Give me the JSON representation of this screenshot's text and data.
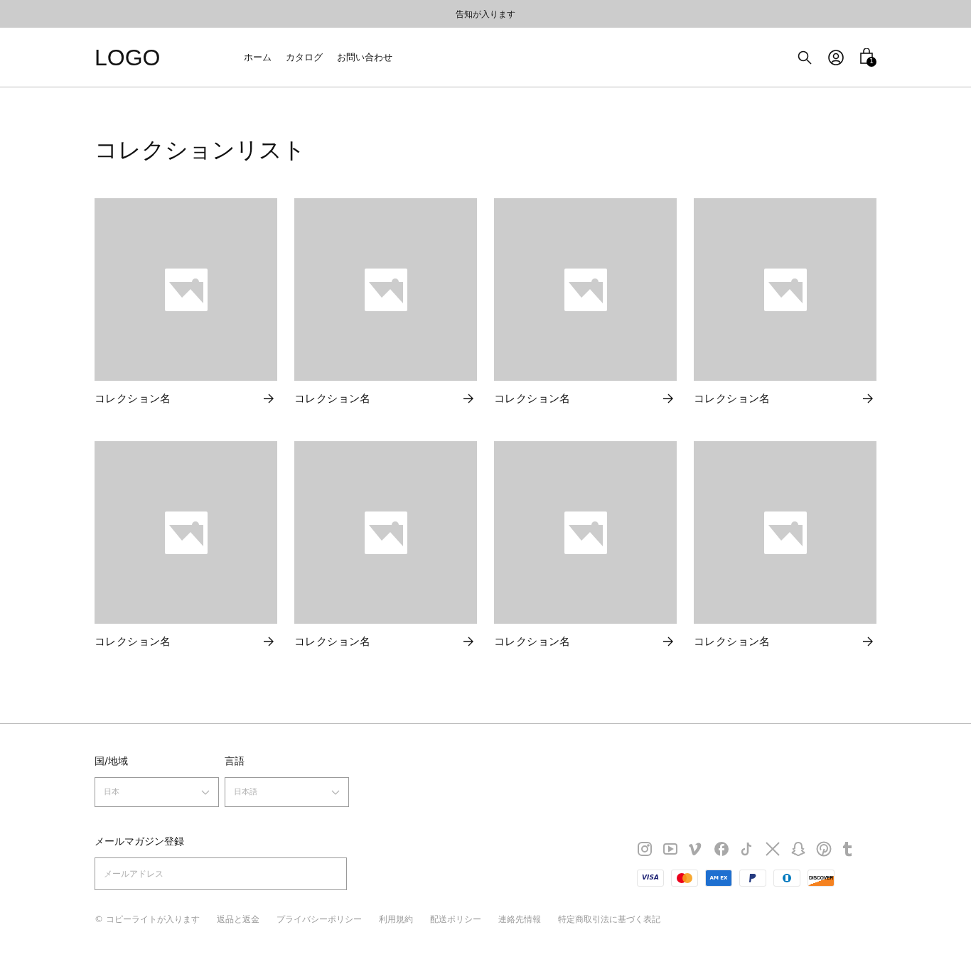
{
  "announcement": "告知が入ります",
  "header": {
    "logo": "LOGO",
    "nav": [
      "ホーム",
      "カタログ",
      "お問い合わせ"
    ],
    "cart_count": "1"
  },
  "title": "コレクションリスト",
  "collections": [
    {
      "name": "コレクション名",
      "kind": "picture"
    },
    {
      "name": "コレクション名",
      "kind": "picture"
    },
    {
      "name": "コレクション名",
      "kind": "picture"
    },
    {
      "name": "コレクション名",
      "kind": "picture"
    },
    {
      "name": "コレクション名",
      "kind": "picture"
    },
    {
      "name": "コレクション名",
      "kind": "picture"
    },
    {
      "name": "コレクション名",
      "kind": "picture"
    },
    {
      "name": "コレクション名",
      "kind": "picture"
    }
  ],
  "footer": {
    "selectors": [
      {
        "label": "国/地域",
        "value": "日本"
      },
      {
        "label": "言語",
        "value": "日本語"
      }
    ],
    "newsletter": {
      "label": "メールマガジン登録",
      "placeholder": "メールアドレス"
    },
    "payments": [
      {
        "kind": "visa",
        "label": "VISA"
      },
      {
        "kind": "mastercard"
      },
      {
        "kind": "amex",
        "label": "AM EX"
      },
      {
        "kind": "paypal"
      },
      {
        "kind": "diners"
      },
      {
        "kind": "discover",
        "label": "DISCOVER"
      }
    ],
    "links": [
      "© コピーライトが入ります",
      "返品と返金",
      "プライバシーポリシー",
      "利用規約",
      "配送ポリシー",
      "連絡先情報",
      "特定商取引法に基づく表記"
    ]
  }
}
